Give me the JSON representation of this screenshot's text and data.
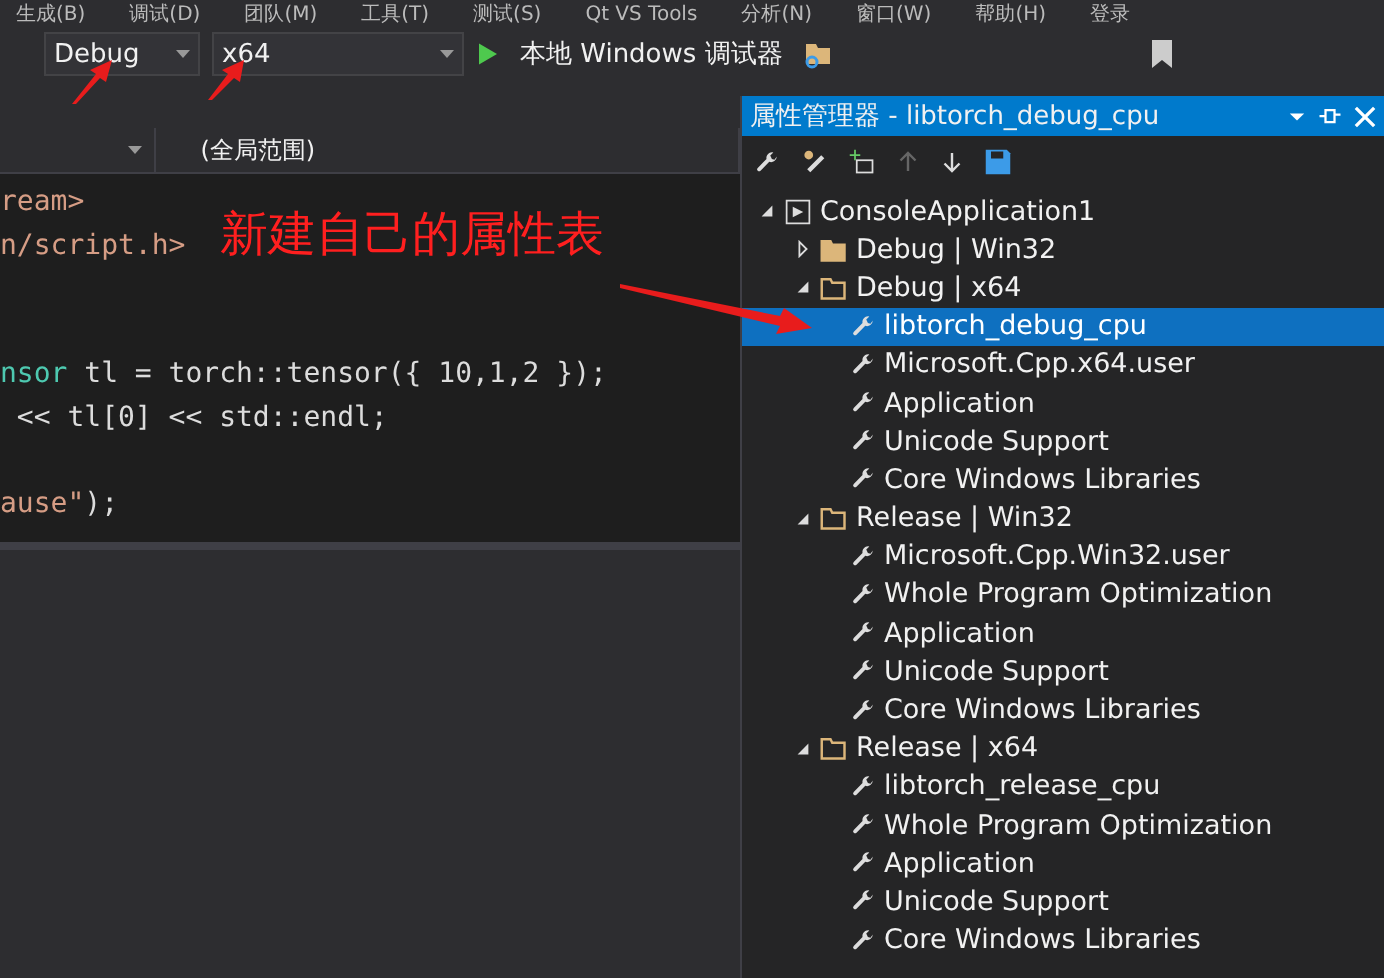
{
  "menu": [
    "生成(B)",
    "调试(D)",
    "团队(M)",
    "工具(T)",
    "测试(S)",
    "Qt VS Tools",
    "分析(N)",
    "窗口(W)",
    "帮助(H)",
    "登录"
  ],
  "toolbar": {
    "configuration": "Debug",
    "platform": "x64",
    "run_label": "本地 Windows 调试器"
  },
  "editor": {
    "scope": "(全局范围)",
    "lines": [
      {
        "kind": "include",
        "text": "ream>"
      },
      {
        "kind": "include",
        "text": "n/script.h>"
      },
      {
        "kind": "blank"
      },
      {
        "kind": "blank"
      },
      {
        "kind": "typed",
        "type_part": "nsor",
        "text": " tl = torch::tensor({ 10,1,2 });"
      },
      {
        "kind": "plain",
        "text": " << tl[0] << std::endl;"
      },
      {
        "kind": "blank"
      },
      {
        "kind": "string",
        "string_part": "ause\"",
        "text": ");"
      }
    ]
  },
  "annotation": "新建自己的属性表",
  "panel": {
    "title": "属性管理器 - libtorch_debug_cpu",
    "tree": [
      {
        "kind": "project",
        "label": "ConsoleApplication1",
        "expanded": true,
        "selected": false,
        "children": [
          {
            "kind": "config",
            "label": "Debug | Win32",
            "expanded": false,
            "selected": false
          },
          {
            "kind": "config",
            "label": "Debug | x64",
            "expanded": true,
            "selected": false,
            "children": [
              {
                "kind": "sheet",
                "label": "libtorch_debug_cpu",
                "selected": true
              },
              {
                "kind": "sheet",
                "label": "Microsoft.Cpp.x64.user",
                "selected": false
              },
              {
                "kind": "sheet",
                "label": "Application",
                "selected": false
              },
              {
                "kind": "sheet",
                "label": "Unicode Support",
                "selected": false
              },
              {
                "kind": "sheet",
                "label": "Core Windows Libraries",
                "selected": false
              }
            ]
          },
          {
            "kind": "config",
            "label": "Release | Win32",
            "expanded": true,
            "selected": false,
            "children": [
              {
                "kind": "sheet",
                "label": "Microsoft.Cpp.Win32.user",
                "selected": false
              },
              {
                "kind": "sheet",
                "label": "Whole Program Optimization",
                "selected": false
              },
              {
                "kind": "sheet",
                "label": "Application",
                "selected": false
              },
              {
                "kind": "sheet",
                "label": "Unicode Support",
                "selected": false
              },
              {
                "kind": "sheet",
                "label": "Core Windows Libraries",
                "selected": false
              }
            ]
          },
          {
            "kind": "config",
            "label": "Release | x64",
            "expanded": true,
            "selected": false,
            "children": [
              {
                "kind": "sheet",
                "label": "libtorch_release_cpu",
                "selected": false
              },
              {
                "kind": "sheet",
                "label": "Whole Program Optimization",
                "selected": false
              },
              {
                "kind": "sheet",
                "label": "Application",
                "selected": false
              },
              {
                "kind": "sheet",
                "label": "Unicode Support",
                "selected": false
              },
              {
                "kind": "sheet",
                "label": "Core Windows Libraries",
                "selected": false
              }
            ]
          }
        ]
      }
    ]
  }
}
